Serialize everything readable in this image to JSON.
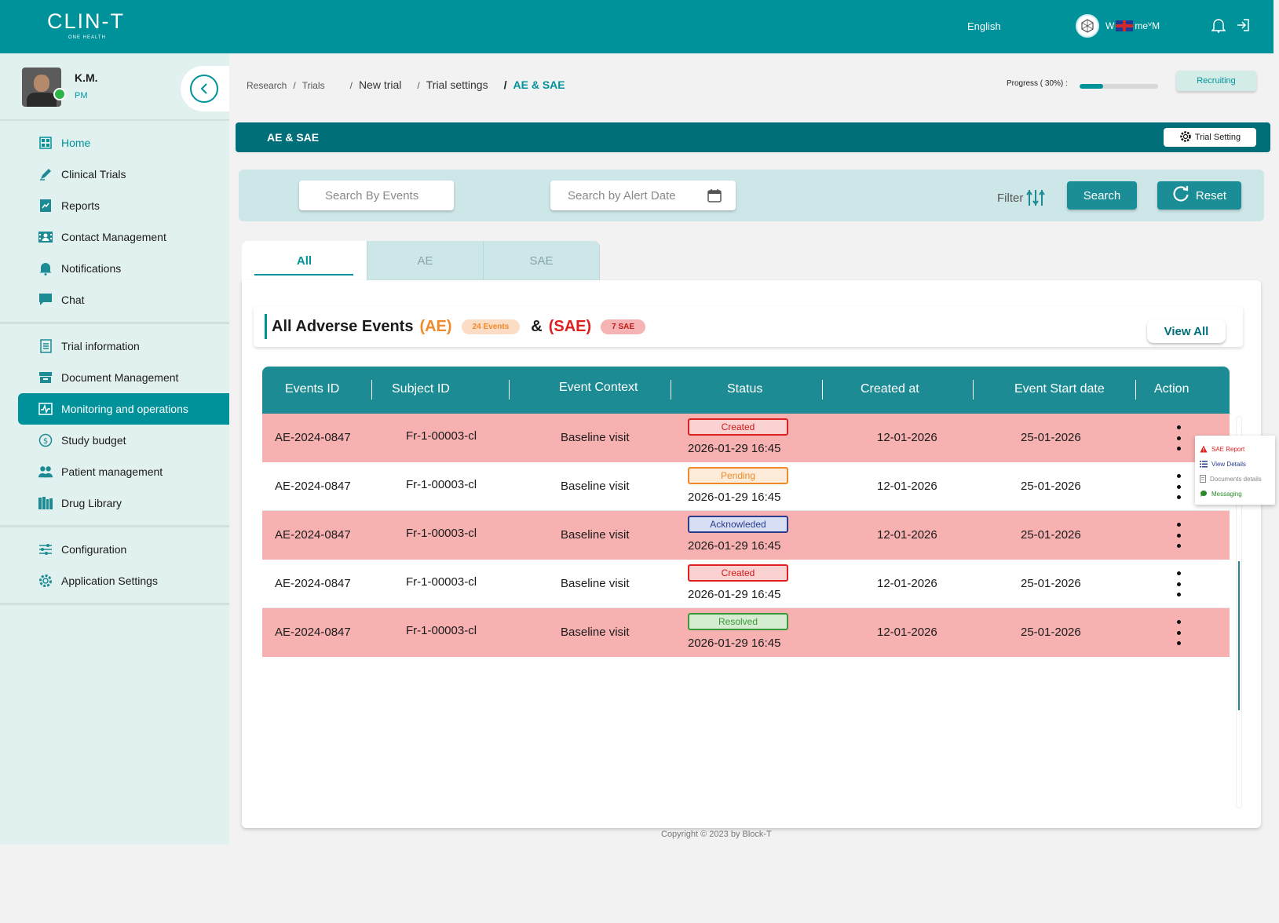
{
  "brand": {
    "name": "CLIN-T",
    "sub": "ONE HEALTH"
  },
  "topbar": {
    "language": "English",
    "user_text": "W",
    "user_text_suffix": "meⱽM"
  },
  "profile": {
    "name": "K.M.",
    "role": "PM"
  },
  "sidebar": {
    "group1": [
      {
        "label": "Home",
        "icon": "grid-icon"
      },
      {
        "label": "Clinical Trials",
        "icon": "pen-icon"
      },
      {
        "label": "Reports",
        "icon": "report-icon"
      },
      {
        "label": "Contact Management",
        "icon": "contact-icon"
      },
      {
        "label": "Notifications",
        "icon": "bell-icon"
      },
      {
        "label": "Chat",
        "icon": "chat-icon"
      }
    ],
    "group2": [
      {
        "label": "Trial information",
        "icon": "document-icon"
      },
      {
        "label": "Document Management",
        "icon": "archive-icon"
      },
      {
        "label": "Monitoring and operations",
        "icon": "pulse-icon"
      },
      {
        "label": "Study budget",
        "icon": "budget-icon"
      },
      {
        "label": "Patient management",
        "icon": "patients-icon"
      },
      {
        "label": "Drug Library",
        "icon": "library-icon"
      }
    ],
    "group3": [
      {
        "label": "Configuration",
        "icon": "sliders-icon"
      },
      {
        "label": "Application Settings",
        "icon": "gear-icon"
      }
    ]
  },
  "breadcrumb": {
    "research": "Research",
    "trials": "Trials",
    "new_trial": "New trial",
    "trial_settings": "Trial settings",
    "current": "AE & SAE",
    "sep": "/"
  },
  "progress": {
    "label": "Progress ( 30%) :",
    "value": 0.3
  },
  "status_chip": "Recruiting",
  "title_band": {
    "title": "AE & SAE",
    "trial_setting": "Trial Setting"
  },
  "filters": {
    "events_placeholder": "Search By Events",
    "date_placeholder": "Search by Alert Date",
    "filter_label": "Filter",
    "search_label": "Search",
    "reset_label": "Reset"
  },
  "tabs": [
    "All",
    "AE",
    "SAE"
  ],
  "card": {
    "title": "All Adverse Events",
    "ae": "(AE)",
    "ae_count": "24 Events",
    "amp": "&",
    "sae": "(SAE)",
    "sae_count": "7 SAE",
    "view_all": "View All"
  },
  "table": {
    "headers": [
      "Events ID",
      "Subject ID",
      "Event Context",
      "Status",
      "Created at",
      "Event Start date",
      "Action"
    ],
    "rows": [
      {
        "event_id": "AE-2024-0847",
        "subject_id": "Fr-1-00003-cl",
        "context": "Baseline visit",
        "status": "Created",
        "status_date": "2026-01-29 16:45",
        "created_at": "12-01-2026",
        "start_date": "25-01-2026"
      },
      {
        "event_id": "AE-2024-0847",
        "subject_id": "Fr-1-00003-cl",
        "context": "Baseline visit",
        "status": "Pending",
        "status_date": "2026-01-29 16:45",
        "created_at": "12-01-2026",
        "start_date": "25-01-2026"
      },
      {
        "event_id": "AE-2024-0847",
        "subject_id": "Fr-1-00003-cl",
        "context": "Baseline visit",
        "status": "Acknowleded",
        "status_date": "2026-01-29 16:45",
        "created_at": "12-01-2026",
        "start_date": "25-01-2026"
      },
      {
        "event_id": "AE-2024-0847",
        "subject_id": "Fr-1-00003-cl",
        "context": "Baseline visit",
        "status": "Created",
        "status_date": "2026-01-29 16:45",
        "created_at": "12-01-2026",
        "start_date": "25-01-2026"
      },
      {
        "event_id": "AE-2024-0847",
        "subject_id": "Fr-1-00003-cl",
        "context": "Baseline visit",
        "status": "Resolved",
        "status_date": "2026-01-29 16:45",
        "created_at": "12-01-2026",
        "start_date": "25-01-2026"
      }
    ]
  },
  "action_menu": [
    "SAE Report",
    "View Details",
    "Documents details",
    "Messaging"
  ],
  "copyright": "Copyright © 2023 by Block-T"
}
